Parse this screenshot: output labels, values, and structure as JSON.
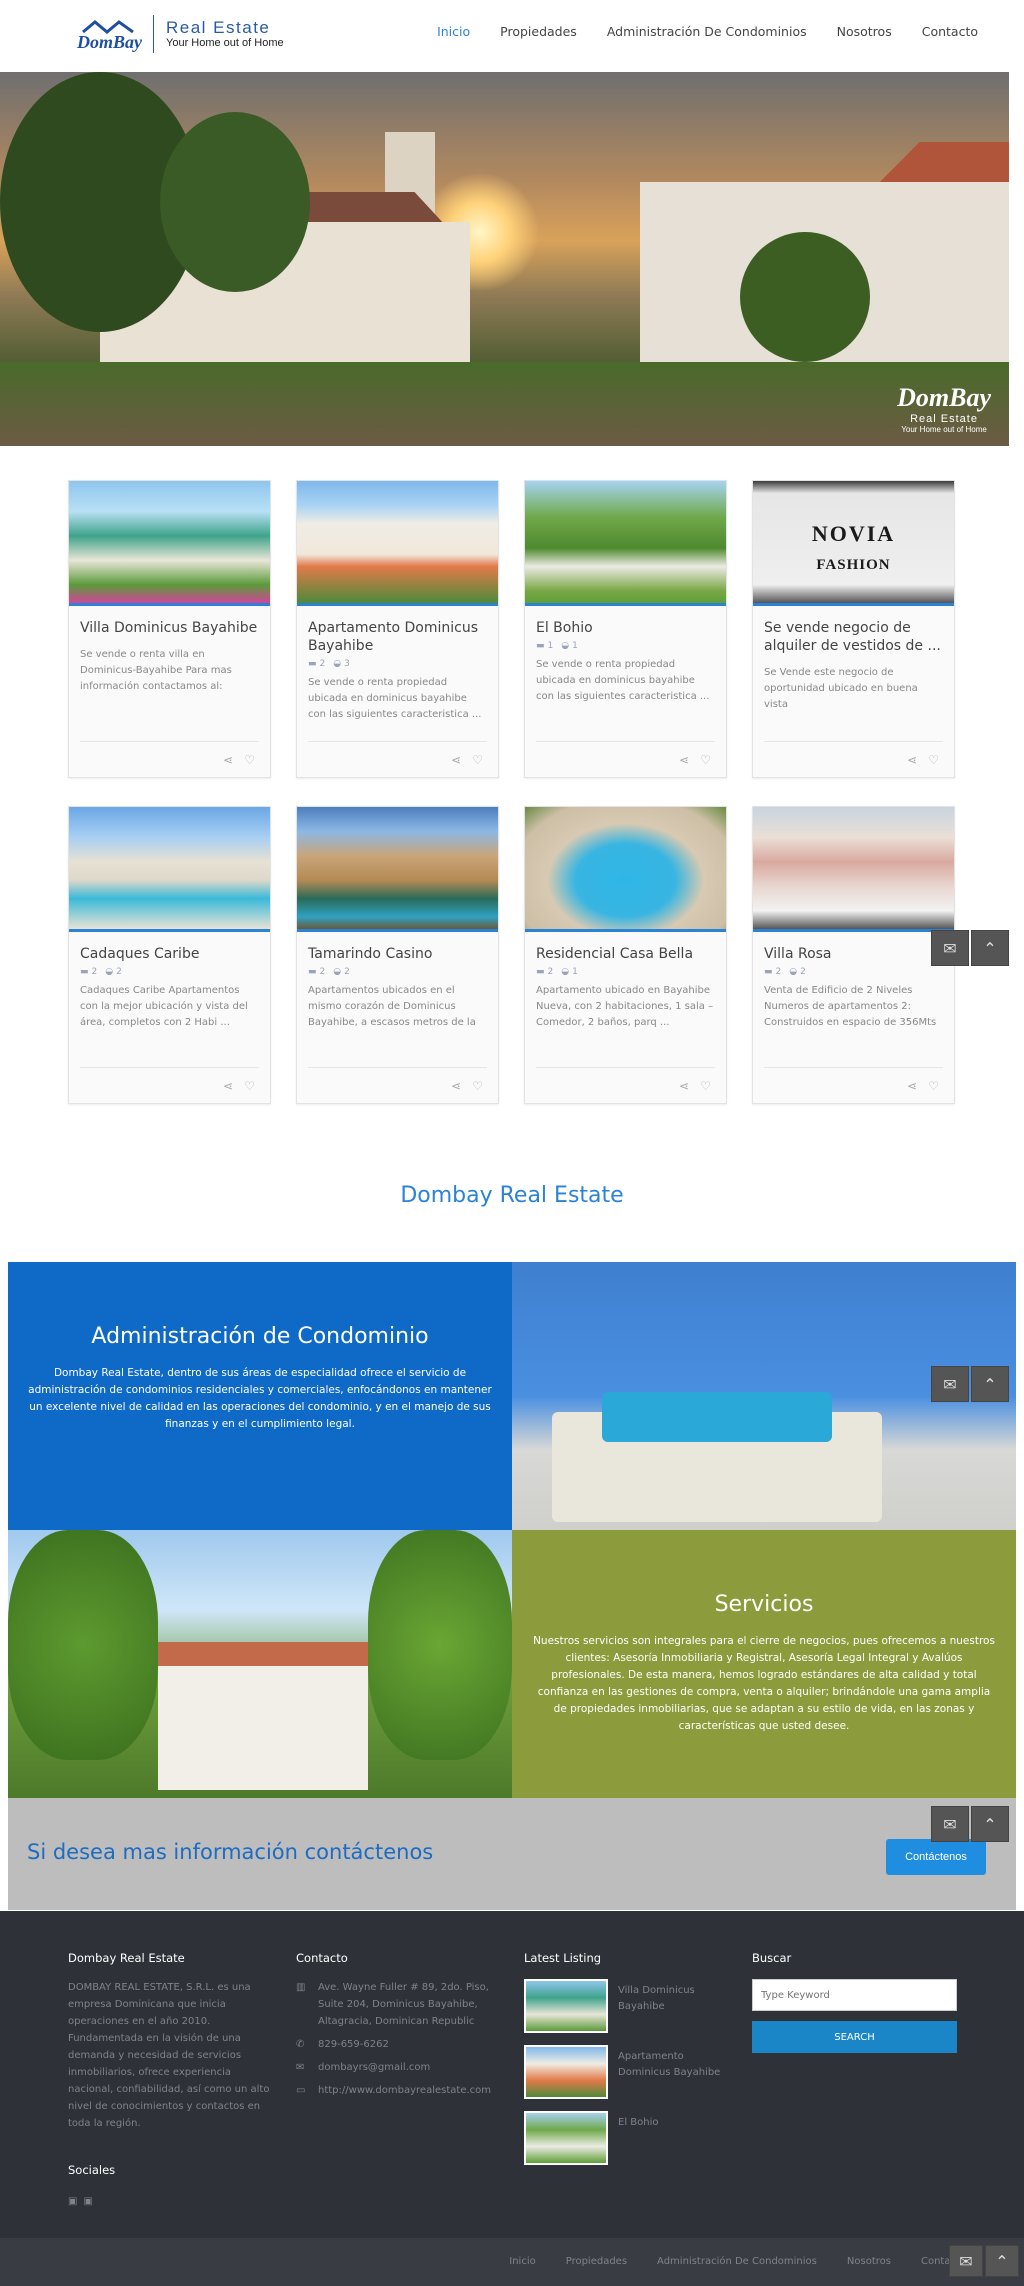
{
  "header": {
    "logo_name": "DomBay",
    "logo_title": "Real Estate",
    "logo_tagline": "Your Home out of Home",
    "nav": [
      "Inicio",
      "Propiedades",
      "Administración De Condominios",
      "Nosotros",
      "Contacto"
    ]
  },
  "hero": {
    "logo_name": "DomBay",
    "logo_sub": "Real Estate",
    "logo_tag": "Your Home out of Home"
  },
  "listings": [
    {
      "title": "Villa Dominicus Bayahibe",
      "beds": null,
      "baths": null,
      "desc": "Se vende o renta villa en Dominicus-Bayahibe Para mas información contactamos al: Teléfon ..."
    },
    {
      "title": "Apartamento Dominicus Bayahibe",
      "beds": "2",
      "baths": "3",
      "desc": "Se vende o renta propiedad ubicada en dominicus bayahibe con las siguientes caracteristica ..."
    },
    {
      "title": "El Bohio",
      "beds": "1",
      "baths": "1",
      "desc": "Se vende o renta propiedad ubicada en dominicus bayahibe con las siguientes caracteristica ..."
    },
    {
      "title": "Se vende negocio de alquiler de vestidos de ...",
      "beds": null,
      "baths": null,
      "desc": "Se Vende este negocio de oportunidad ubicado en buena vista"
    },
    {
      "title": "Cadaques Caribe",
      "beds": "2",
      "baths": "2",
      "desc": "Cadaques Caribe Apartamentos con la mejor ubicación y vista del área, completos con 2 Habi ..."
    },
    {
      "title": "Tamarindo Casino",
      "beds": "2",
      "baths": "2",
      "desc": "Apartamentos ubicados en el mismo corazón de Dominicus Bayahibe, a escasos metros de la Pl ..."
    },
    {
      "title": "Residencial Casa Bella",
      "beds": "2",
      "baths": "1",
      "desc": "Apartamento ubicado en Bayahibe Nueva, con 2 habitaciones, 1 sala – Comedor, 2 baños, parq ..."
    },
    {
      "title": "Villa Rosa",
      "beds": "2",
      "baths": "2",
      "desc": "Venta de Edificio de 2 Niveles Numeros de apartamentos 2: Construidos en espacio de 356Mts ..."
    }
  ],
  "listing_image_text": {
    "novia": "NOVIA",
    "fashion": "FASHION"
  },
  "section_title": "Dombay Real Estate",
  "condo": {
    "title": "Administración de Condominio",
    "text": "Dombay Real Estate, dentro de sus áreas de especialidad ofrece el servicio de administración de condominios residenciales y comerciales, enfocándonos en mantener un excelente nivel de calidad en las operaciones del condominio, y en el manejo de sus finanzas y en el cumplimiento legal."
  },
  "services": {
    "title": "Servicios",
    "text": "Nuestros servicios son integrales para el cierre de negocios, pues ofrecemos a nuestros clientes: Asesoría Inmobiliaria y Registral, Asesoría Legal Integral y Avalúos profesionales. De esta manera, hemos logrado estándares de alta calidad y total confianza en las gestiones de compra, venta o alquiler; brindándole una gama amplia de propiedades inmobiliarias, que se adaptan a su estilo de vida, en las zonas y características que usted desee."
  },
  "cta": {
    "text": "Si desea mas información contáctenos",
    "button": "Contáctenos"
  },
  "footer": {
    "about_title": "Dombay Real Estate",
    "about_text": "DOMBAY REAL ESTATE, S.R.L. es una empresa Dominicana que inicia operaciones en el año 2010. Fundamentada en la visión de una demanda y necesidad de servicios inmobiliarios, ofrece experiencia nacional, confiabilidad, así como un alto nivel de conocimientos y contactos en toda la región.",
    "contact_title": "Contacto",
    "address": "Ave. Wayne Fuller # 89, 2do. Piso, Suite 204, Dominicus Bayahibe, Altagracia, Dominican Republic",
    "phone": "829-659-6262",
    "email": "dombayrs@gmail.com",
    "website": "http://www.dombayrealestate.com",
    "latest_title": "Latest Listing",
    "latest": [
      "Villa Dominicus Bayahibe",
      "Apartamento Dominicus Bayahibe",
      "El Bohio"
    ],
    "search_title": "Buscar",
    "search_placeholder": "Type Keyword",
    "search_button": "SEARCH",
    "social_title": "Sociales"
  },
  "bottom_nav": [
    "Inicio",
    "Propiedades",
    "Administración De Condominios",
    "Nosotros",
    "Contacto"
  ],
  "colors": {
    "accent": "#2b83d6",
    "condo_bg": "#0f6ac7",
    "services_bg": "#8c9b3c",
    "footer_bg": "#2e3138"
  }
}
